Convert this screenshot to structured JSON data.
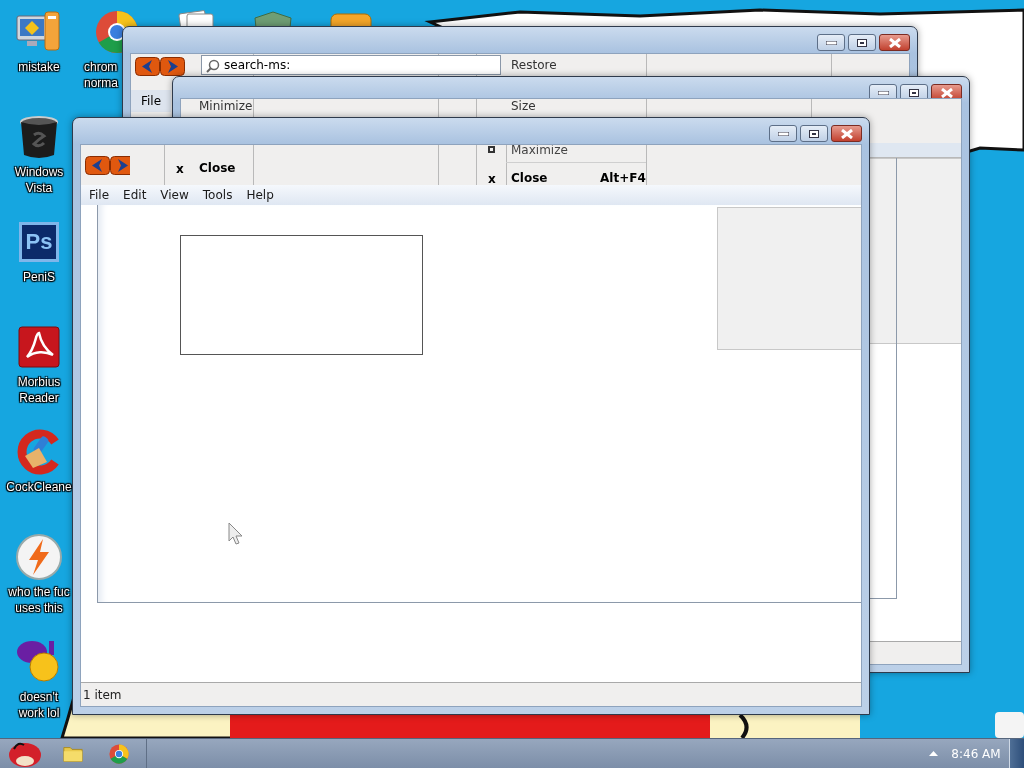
{
  "desktop_icons": [
    {
      "kind": "computer",
      "label": [
        "mistake"
      ]
    },
    {
      "kind": "bin",
      "label": [
        "Windows",
        "Vista"
      ]
    },
    {
      "kind": "ps",
      "glyph": "Ps",
      "label": [
        "PeniS"
      ]
    },
    {
      "kind": "reader",
      "label": [
        "Morbius",
        "Reader"
      ]
    },
    {
      "kind": "cleaner",
      "label": [
        "CockCleane"
      ]
    },
    {
      "kind": "bolt",
      "label": [
        "who the fuc",
        "uses this"
      ]
    },
    {
      "kind": "messenger",
      "label": [
        "doesn't",
        "work lol"
      ]
    }
  ],
  "desktop_top_row": [
    {
      "kind": "browser",
      "label": [
        "chrom",
        "norma"
      ]
    },
    {
      "kind": "cards"
    },
    {
      "kind": "shield"
    },
    {
      "kind": "frog"
    }
  ],
  "back_window": {
    "remnant": "Restore",
    "search": {
      "value": "search-ms:"
    },
    "menu": [
      "File"
    ]
  },
  "middle_window": {
    "remnants": [
      "Minimize",
      "Size"
    ]
  },
  "front_window": {
    "remnant_menu": [
      {
        "glyph": "x",
        "label": "Close"
      }
    ],
    "system_menu": [
      {
        "kind": "maximize",
        "label": "Maximize"
      },
      {
        "kind": "close",
        "glyph": "x",
        "label": "Close",
        "shortcut": "Alt+F4"
      }
    ],
    "menu": [
      "File",
      "Edit",
      "View",
      "Tools",
      "Help"
    ],
    "status": "1 item"
  },
  "taskbar": {
    "pinned": [
      {
        "kind": "folder"
      },
      {
        "kind": "browser"
      }
    ],
    "clock": "8:46 AM"
  }
}
